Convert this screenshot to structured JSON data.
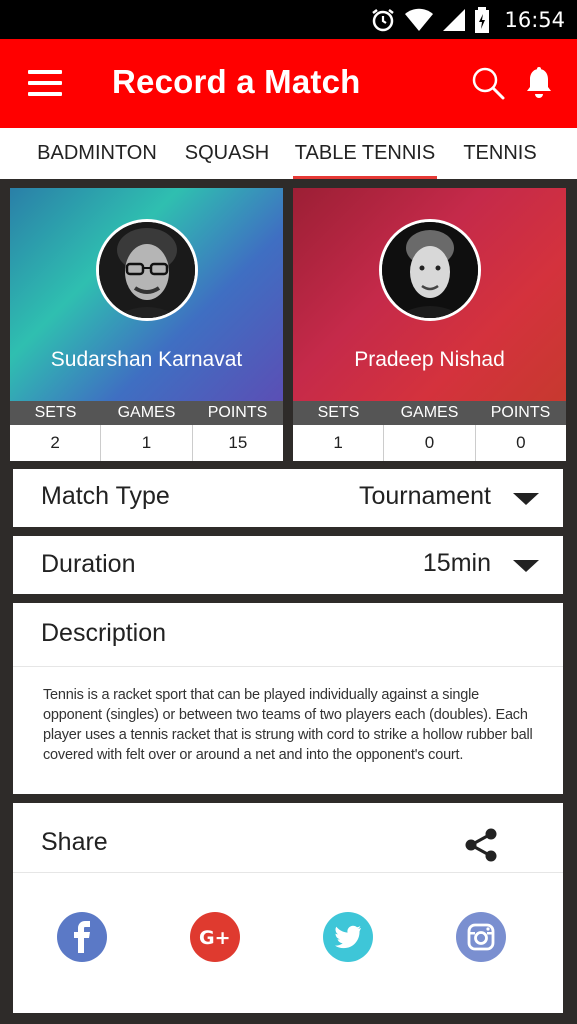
{
  "status_bar": {
    "time": "16:54"
  },
  "app_bar": {
    "title": "Record a Match"
  },
  "tabs": [
    {
      "label": "BADMINTON"
    },
    {
      "label": "SQUASH"
    },
    {
      "label": "TABLE TENNIS",
      "active": true
    },
    {
      "label": "TENNIS"
    }
  ],
  "players": [
    {
      "name": "Sudarshan Karnavat",
      "stats": {
        "sets": "2",
        "games": "1",
        "points": "15"
      }
    },
    {
      "name": "Pradeep Nishad",
      "stats": {
        "sets": "1",
        "games": "0",
        "points": "0"
      }
    }
  ],
  "stat_headers": {
    "sets": "SETS",
    "games": "GAMES",
    "points": "POINTS"
  },
  "match_type": {
    "label": "Match Type",
    "value": "Tournament"
  },
  "duration": {
    "label": "Duration",
    "value": "15min"
  },
  "description": {
    "title": "Description",
    "text": "Tennis is a racket sport that can be played individually against a single opponent (singles) or between two teams of two players each (doubles). Each player uses a tennis racket that is strung with cord to strike a hollow rubber ball covered with felt over or around a net and into the opponent's court."
  },
  "share": {
    "title": "Share",
    "networks": [
      {
        "name": "facebook-icon",
        "color": "#3b5998"
      },
      {
        "name": "google-plus-icon",
        "color": "#dd4b39"
      },
      {
        "name": "twitter-icon",
        "color": "#1dcaff"
      },
      {
        "name": "instagram-icon",
        "color": "#6a7fc8"
      }
    ]
  },
  "colors": {
    "brand": "#ff0000",
    "tab_indicator": "#e53935"
  }
}
